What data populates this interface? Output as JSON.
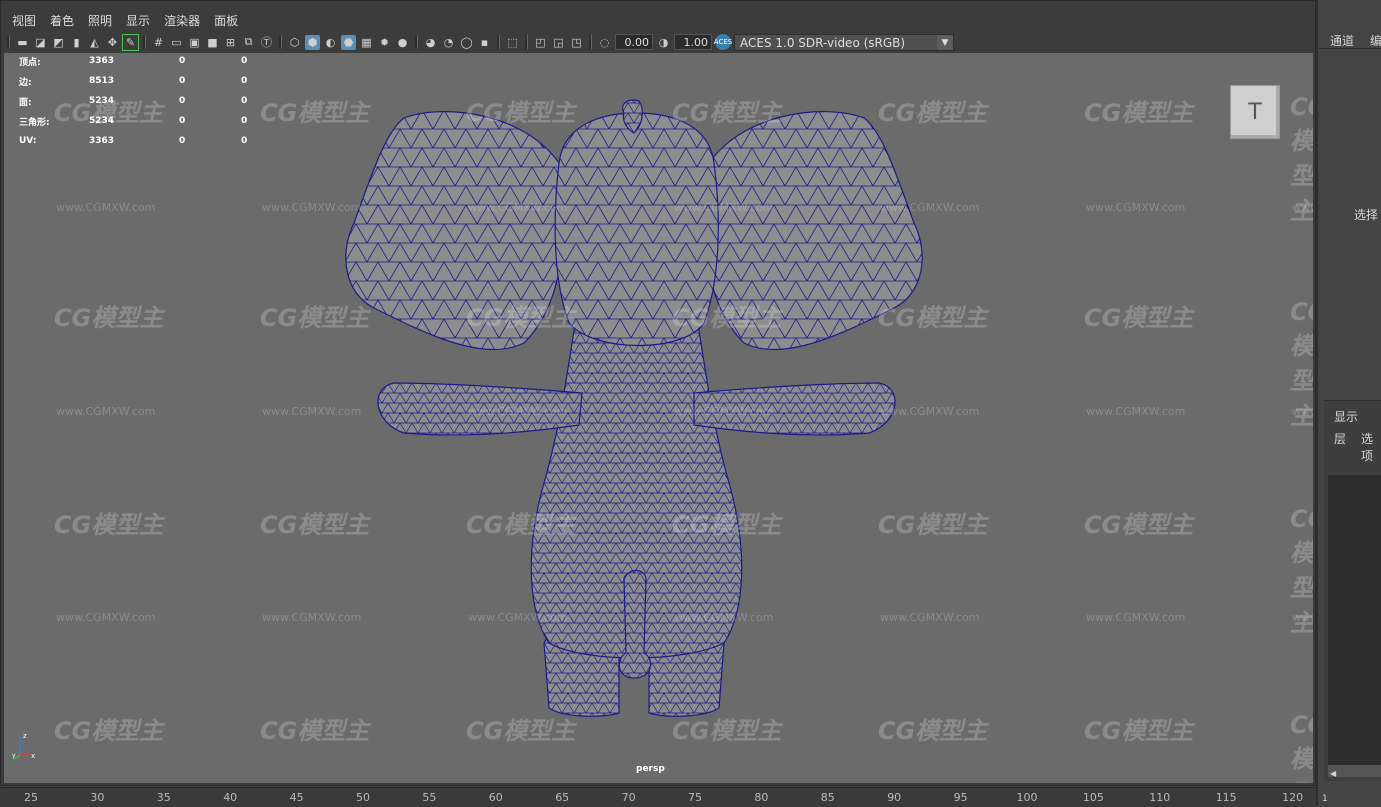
{
  "menubar": [
    "视图",
    "着色",
    "照明",
    "显示",
    "渲染器",
    "面板"
  ],
  "toolbar": {
    "exposure": "0.00",
    "gamma": "1.00",
    "colorspace": "ACES 1.0 SDR-video (sRGB)",
    "aces_badge": "ACES"
  },
  "hud": [
    {
      "label": "顶点:",
      "value": "3363",
      "c1": "0",
      "c2": "0"
    },
    {
      "label": "边:",
      "value": "8513",
      "c1": "0",
      "c2": "0"
    },
    {
      "label": "面:",
      "value": "5234",
      "c1": "0",
      "c2": "0"
    },
    {
      "label": "三角形:",
      "value": "5234",
      "c1": "0",
      "c2": "0"
    },
    {
      "label": "UV:",
      "value": "3363",
      "c1": "0",
      "c2": "0"
    }
  ],
  "viewcube_face": "T",
  "camera": "persp",
  "axis": {
    "x": "x",
    "y": "y",
    "z": "z"
  },
  "watermark": {
    "logo": "CG模型主",
    "url": "www.CGMXW.com"
  },
  "right_panel": {
    "tab1": "通道",
    "tab2": "编",
    "select_label": "选择",
    "display_label": "显示",
    "layers_label": "层",
    "options_label": "选项",
    "bottom_num": "1"
  },
  "ruler": [
    "25",
    "30",
    "35",
    "40",
    "45",
    "50",
    "55",
    "60",
    "65",
    "70",
    "75",
    "80",
    "85",
    "90",
    "95",
    "100",
    "105",
    "110",
    "115",
    "120"
  ],
  "colors": {
    "wire": "#1c1a8a",
    "mesh": "#8d8d8d",
    "viewport_bg": "#6b6b6b"
  }
}
